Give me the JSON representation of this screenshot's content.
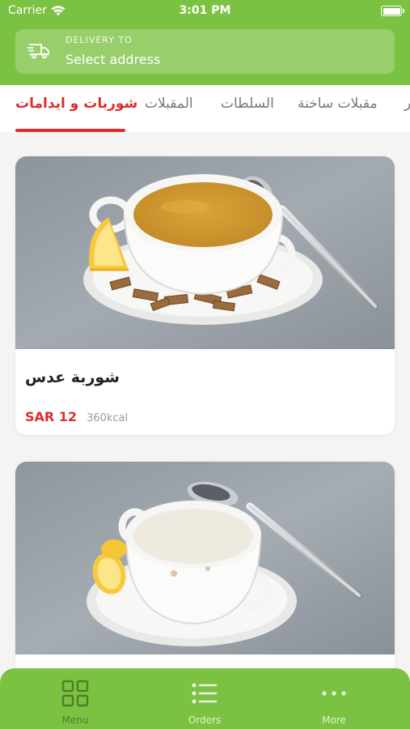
{
  "status_bar": {
    "carrier": "Carrier",
    "time": "3:01 PM"
  },
  "delivery": {
    "label": "DELIVERY TO",
    "address": "Select address",
    "icon": "truck-icon"
  },
  "tabs": [
    {
      "label": "شوربات و ايدامات",
      "active": true
    },
    {
      "label": "المقبلات",
      "active": false
    },
    {
      "label": "السلطات",
      "active": false
    },
    {
      "label": "مقبلات ساخنة",
      "active": false
    },
    {
      "label": "ر",
      "active": false
    }
  ],
  "items": [
    {
      "name": "شوربة عدس",
      "price": "SAR 12",
      "calories": "360kcal"
    },
    {
      "name": "",
      "price": "",
      "calories": ""
    }
  ],
  "bottom_nav": [
    {
      "label": "Menu",
      "icon": "grid-icon",
      "active": true
    },
    {
      "label": "Orders",
      "icon": "list-icon",
      "active": false
    },
    {
      "label": "More",
      "icon": "more-icon",
      "active": false
    }
  ],
  "colors": {
    "brand_green": "#7cc242",
    "accent_red": "#e02b2b"
  }
}
